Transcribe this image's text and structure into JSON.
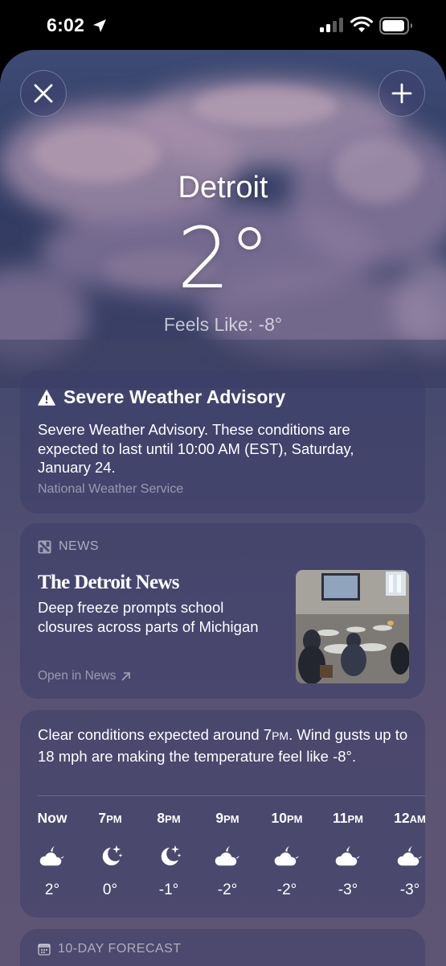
{
  "status_bar": {
    "time": "6:02"
  },
  "location": {
    "city": "Detroit",
    "temperature": "2°",
    "feels_like": "Feels Like: -8°"
  },
  "advisory": {
    "title": "Severe Weather Advisory",
    "body": "Severe Weather Advisory. These conditions are expected to last until 10:00 AM (EST), Saturday, January 24.",
    "source": "National Weather Service"
  },
  "news": {
    "header": "NEWS",
    "publisher": "The Detroit News",
    "headline": "Deep freeze prompts school closures across parts of Michigan",
    "link": "Open in News"
  },
  "hourly": {
    "description": {
      "before": "Clear conditions expected around 7",
      "ampm": "PM",
      "after": ". Wind gusts up to 18 mph are making the temperature feel like -8°."
    },
    "hours": [
      {
        "hour": "Now",
        "ampm": "",
        "icon": "partly-cloudy-night-icon",
        "temp": "2°"
      },
      {
        "hour": "7",
        "ampm": "PM",
        "icon": "clear-night-icon",
        "temp": "0°"
      },
      {
        "hour": "8",
        "ampm": "PM",
        "icon": "clear-night-icon",
        "temp": "-1°"
      },
      {
        "hour": "9",
        "ampm": "PM",
        "icon": "partly-cloudy-night-icon",
        "temp": "-2°"
      },
      {
        "hour": "10",
        "ampm": "PM",
        "icon": "partly-cloudy-night-icon",
        "temp": "-2°"
      },
      {
        "hour": "11",
        "ampm": "PM",
        "icon": "partly-cloudy-night-icon",
        "temp": "-3°"
      },
      {
        "hour": "12",
        "ampm": "AM",
        "icon": "partly-cloudy-night-icon",
        "temp": "-3°"
      }
    ]
  },
  "forecast": {
    "header": "10-DAY FORECAST"
  }
}
